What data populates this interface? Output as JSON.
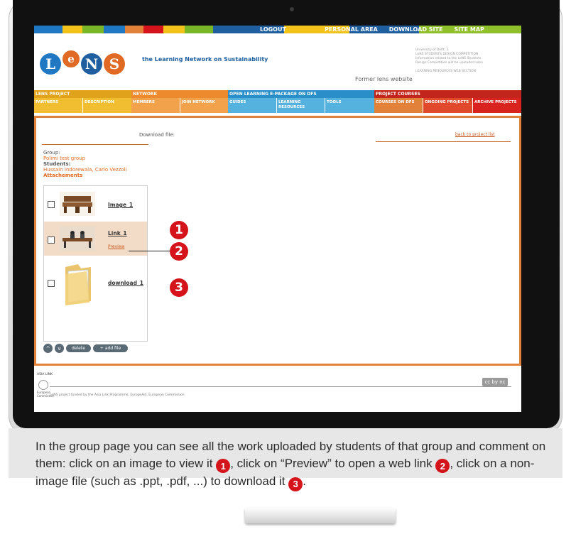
{
  "nav": {
    "logout": "LOGOUT",
    "personal_area": "PERSONAL AREA",
    "download_site": "DOWNLOAD SITE",
    "site_map": "SITE MAP"
  },
  "header": {
    "logo_letters": [
      "L",
      "e",
      "N",
      "S"
    ],
    "tagline": "the Learning Network on Sustainability",
    "former_site": "Former lens website",
    "side_info": [
      "University of Delft, 2",
      "LeNS STUDENTS DESIGN COMPETITION",
      "Information related to the LeNS Students",
      "Design Competition will be uploaded soon",
      "LEARNING RESOURCES WEB SECTION"
    ]
  },
  "menu": {
    "lens_project": "LENS PROJECT",
    "partners": "PARTNERS",
    "description": "DESCRIPTION",
    "network": "NETWORK",
    "members": "MEMBERS",
    "join_network": "JOIN NETWORK",
    "open_learning": "OPEN LEARNING E-PACKAGE ON DFS",
    "guides": "GUIDES",
    "learning_resources": "LEARNING RESOURCES",
    "tools": "TOOLS",
    "project_courses": "PROJECT COURSES",
    "courses_on_dfs": "COURSES ON DFS",
    "ongoing_projects": "ONGOING PROJECTS",
    "archive_projects": "ARCHIVE PROJECTS"
  },
  "main": {
    "download_title": "Download file:",
    "back_link": "back to project list",
    "group_label": "Group:",
    "group_value": "Polimi test group",
    "students_label": "Students:",
    "students_value": "Hussain Indorewala, Carlo Vezzoli",
    "attachments_label": "Attachements",
    "items": [
      {
        "label": "Image_1"
      },
      {
        "label": "Link_1",
        "preview": "Preview"
      },
      {
        "label": "download_1"
      }
    ],
    "buttons": {
      "up": "^",
      "down": "v",
      "delete": "delete",
      "add_file": "+ add file"
    }
  },
  "badges": [
    "1",
    "2",
    "3"
  ],
  "footer": {
    "asia_link": "ASIA LINK",
    "eu_text": "European Commission",
    "funding": "LeNS project funded by the Asia Link Programme, EuropeAid, European Commission",
    "cc": "cc by nc"
  },
  "caption": {
    "part1": "In the group page you can see all the work uploaded by students of that group and comment on them: click on an image to view it",
    "part2": ", click on “Preview” to open a web link",
    "part3": ", click on a non-image file (such as .ppt, .pdf, ...) to download it",
    "part4": "."
  },
  "colors": {
    "orange": "#e1813a",
    "red_badge": "#d4141a",
    "blue_logo": "#1f78c1"
  }
}
